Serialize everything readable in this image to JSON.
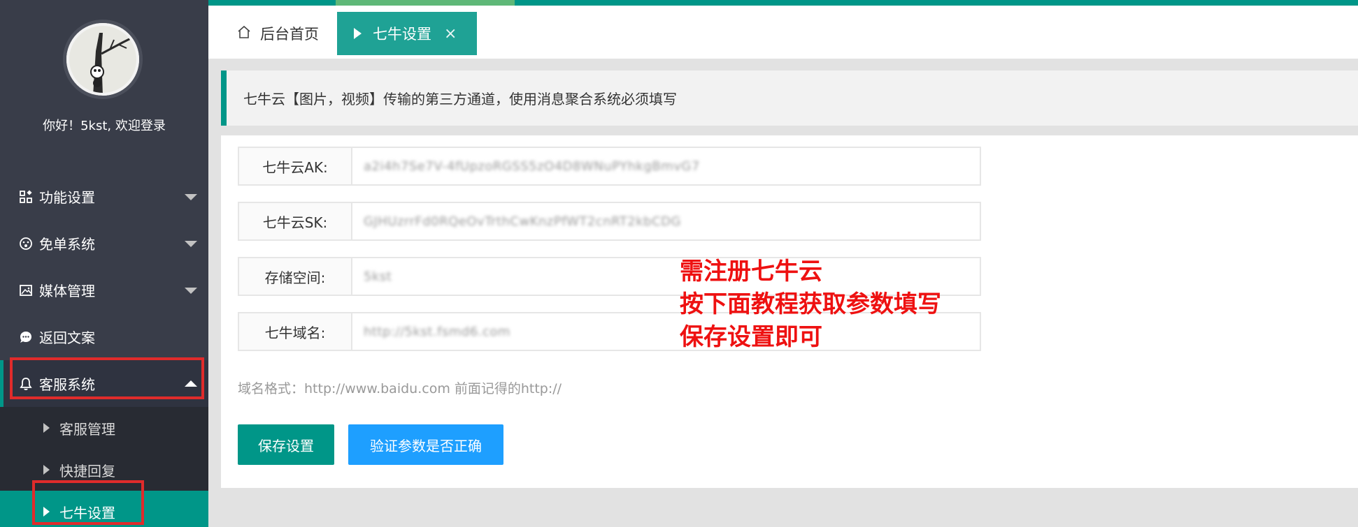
{
  "sidebar": {
    "greeting": "你好！5kst, 欢迎登录",
    "menu": [
      {
        "label": "功能设置",
        "icon": "apps-icon"
      },
      {
        "label": "免单系统",
        "icon": "face-icon"
      },
      {
        "label": "媒体管理",
        "icon": "picture-icon"
      },
      {
        "label": "返回文案",
        "icon": "chat-icon"
      },
      {
        "label": "客服系统",
        "icon": "bell-icon"
      }
    ],
    "submenu": [
      {
        "label": "客服管理"
      },
      {
        "label": "快捷回复"
      },
      {
        "label": "七牛设置"
      }
    ]
  },
  "tabs": {
    "home": "后台首页",
    "current": "七牛设置",
    "close": "×"
  },
  "notice": "七牛云【图片，视频】传输的第三方通道，使用消息聚合系统必须填写",
  "form": {
    "fields": [
      {
        "label": "七牛云AK:",
        "value": "a2i4h7Se7V-4fUpzoRGSS5zO4D8WNuPYhkgBmvG7"
      },
      {
        "label": "七牛云SK:",
        "value": "GJHUzrrFd0RQeOvTrthCwKnzPfWT2cnRT2kbCDG"
      },
      {
        "label": "存储空间:",
        "value": "5kst"
      },
      {
        "label": "七牛域名:",
        "value": "http://5kst.fsmd6.com"
      }
    ],
    "hint": "域名格式：http://www.baidu.com 前面记得的http://",
    "save_label": "保存设置",
    "verify_label": "验证参数是否正确"
  },
  "annotation": [
    "需注册七牛云",
    "按下面教程获取参数填写",
    "保存设置即可"
  ],
  "colors": {
    "accent": "#009688",
    "blue": "#1e9fff",
    "sidebar": "#393d49",
    "annotation": "#ee1111"
  }
}
